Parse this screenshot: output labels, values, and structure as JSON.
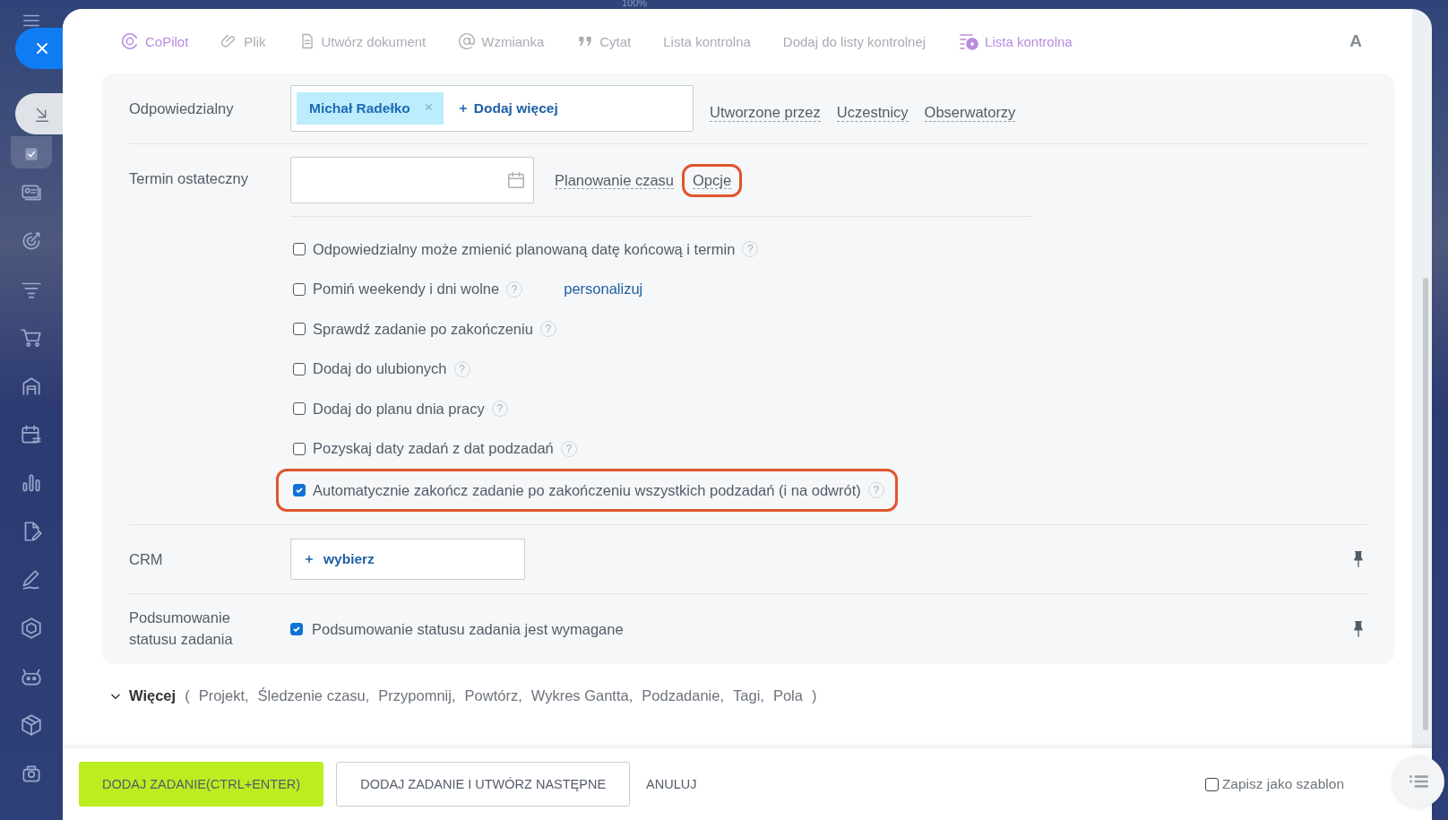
{
  "zoom_label": "100%",
  "toolbar": {
    "items": [
      {
        "label": "CoPilot",
        "kind": "copilot"
      },
      {
        "label": "Plik",
        "kind": "clip"
      },
      {
        "label": "Utwórz dokument",
        "kind": "doc"
      },
      {
        "label": "Wzmianka",
        "kind": "at"
      },
      {
        "label": "Cytat",
        "kind": "quote"
      },
      {
        "label": "Lista kontrolna",
        "kind": "plain"
      },
      {
        "label": "Dodaj do listy kontrolnej",
        "kind": "plain"
      },
      {
        "label": "Lista kontrolna",
        "kind": "ai-list"
      }
    ],
    "font_button": "A"
  },
  "responsible": {
    "label": "Odpowiedzialny",
    "chip": "Michał Radełko",
    "add_more": "Dodaj więcej",
    "links": [
      "Utworzone przez",
      "Uczestnicy",
      "Obserwatorzy"
    ]
  },
  "deadline": {
    "label": "Termin ostateczny",
    "links": [
      {
        "label": "Planowanie czasu",
        "highlighted": false
      },
      {
        "label": "Opcje",
        "highlighted": true
      }
    ]
  },
  "options": [
    {
      "label": "Odpowiedzialny może zmienić planowaną datę końcową i termin",
      "checked": false,
      "help": "?",
      "highlighted": false
    },
    {
      "label": "Pomiń weekendy i dni wolne",
      "checked": false,
      "help": "?",
      "link": "personalizuj",
      "highlighted": false
    },
    {
      "label": "Sprawdź zadanie po zakończeniu",
      "checked": false,
      "help": "?",
      "highlighted": false
    },
    {
      "label": "Dodaj do ulubionych",
      "checked": false,
      "help": "?",
      "highlighted": false
    },
    {
      "label": "Dodaj do planu dnia pracy",
      "checked": false,
      "help": "?",
      "highlighted": false
    },
    {
      "label": "Pozyskaj daty zadań z dat podzadań",
      "checked": false,
      "help": "?",
      "highlighted": false
    },
    {
      "label": "Automatycznie zakończ zadanie po zakończeniu wszystkich podzadań (i na odwrót)",
      "checked": true,
      "help": "?",
      "highlighted": true
    }
  ],
  "crm": {
    "label": "CRM",
    "button": "wybierz"
  },
  "summary": {
    "label": "Podsumowanie statusu zadania",
    "checked": true,
    "text": "Podsumowanie statusu zadania jest wymagane"
  },
  "more": {
    "label": "Więcej",
    "open": "(",
    "close": ")",
    "items": [
      "Projekt,",
      "Śledzenie czasu,",
      "Przypomnij,",
      "Powtórz,",
      "Wykres Gantta,",
      "Podzadanie,",
      "Tagi,",
      "Pola"
    ]
  },
  "footer": {
    "buttons": [
      {
        "label": "DODAJ ZADANIE(CTRL+ENTER)",
        "kind": "primary"
      },
      {
        "label": "DODAJ ZADANIE I UTWÓRZ NASTĘPNE",
        "kind": "outline"
      },
      {
        "label": "ANULUJ",
        "kind": "link"
      }
    ],
    "template": {
      "label": "Zapisz jako szablon",
      "checked": false
    }
  }
}
